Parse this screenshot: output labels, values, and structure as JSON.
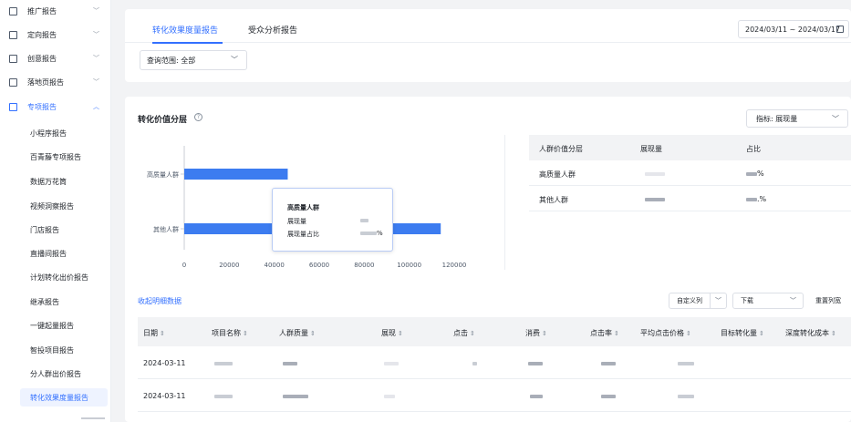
{
  "sidebar": {
    "menus": [
      {
        "label": "推广报告",
        "icon": "chart-icon"
      },
      {
        "label": "定向报告",
        "icon": "target-icon"
      },
      {
        "label": "创意报告",
        "icon": "image-icon"
      },
      {
        "label": "落地页报告",
        "icon": "page-icon"
      },
      {
        "label": "专项报告",
        "icon": "folder-icon",
        "active": true
      }
    ],
    "sub_items": [
      "小程序报告",
      "百青藤专项报告",
      "数据万花筒",
      "视频洞察报告",
      "门店报告",
      "直播间报告",
      "计划转化出价报告",
      "继承报告",
      "一键起量报告",
      "智投项目报告",
      "分人群出价报告",
      "转化效果度量报告"
    ],
    "active_sub": "转化效果度量报告"
  },
  "header": {
    "tabs": [
      "转化效果度量报告",
      "受众分析报告"
    ],
    "date_range": "2024/03/11 ~ 2024/03/17",
    "scope_label": "查询范围: 全部"
  },
  "section": {
    "title": "转化价值分层",
    "metric_label": "指标: 展现量"
  },
  "chart_data": {
    "type": "bar",
    "orientation": "horizontal",
    "categories": [
      "高质量人群",
      "其他人群"
    ],
    "values": [
      46000,
      114000
    ],
    "xlim": [
      0,
      120000
    ],
    "xticks": [
      "0",
      "20000",
      "40000",
      "60000",
      "80000",
      "100000",
      "120000"
    ],
    "color": "#3c7cf0"
  },
  "tooltip": {
    "title": "高质量人群",
    "row1_label": "展现量",
    "row2_label": "展现量占比",
    "row2_suffix": "%"
  },
  "right_table": {
    "headers": [
      "人群价值分层",
      "展现量",
      "占比"
    ],
    "rows": [
      {
        "name": "高质量人群",
        "pct_suffix": "%"
      },
      {
        "name": "其他人群",
        "pct_suffix": ".%"
      }
    ]
  },
  "detail": {
    "collapse_label": "收起明细数据",
    "custom_cols_label": "自定义列",
    "download_label": "下载",
    "reset_label": "重置列宽",
    "headers": [
      "日期",
      "项目名称",
      "人群质量",
      "展现",
      "点击",
      "消费",
      "点击率",
      "平均点击价格",
      "目标转化量",
      "深度转化成本"
    ],
    "rows": [
      {
        "date": "2024-03-11"
      },
      {
        "date": "2024-03-11"
      }
    ]
  }
}
